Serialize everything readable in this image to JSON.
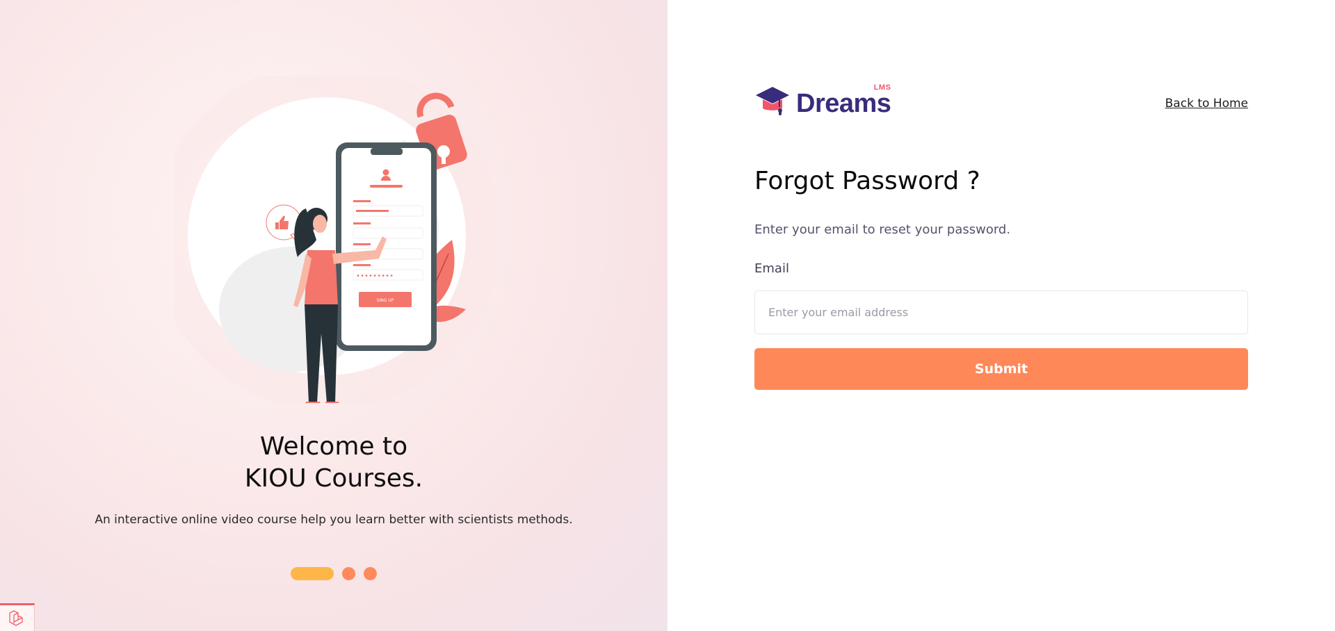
{
  "brand": {
    "logo_text": "Dreams",
    "logo_superscript": "LMS",
    "colors": {
      "primary": "#392c7d",
      "accent": "#ff8858",
      "pink": "#f1556a"
    }
  },
  "nav": {
    "back_home_label": "Back to Home"
  },
  "form": {
    "title": "Forgot Password ?",
    "subtitle": "Enter your email to reset your password.",
    "email_label": "Email",
    "email_placeholder": "Enter your email address",
    "email_value": "",
    "submit_label": "Submit"
  },
  "promo": {
    "illustration_button_text": "SING UP",
    "title_line1": "Welcome to",
    "title_line2": "KIOU Courses.",
    "subtitle": "An interactive online video course help you learn better with scientists methods.",
    "carousel": {
      "total_slides": 3,
      "active_index": 0
    }
  },
  "icons": {
    "logo": "graduation-cap-icon",
    "corner": "laravel-logo-icon",
    "lock": "padlock-icon",
    "thumbs_up": "thumbs-up-icon",
    "user": "user-icon"
  }
}
